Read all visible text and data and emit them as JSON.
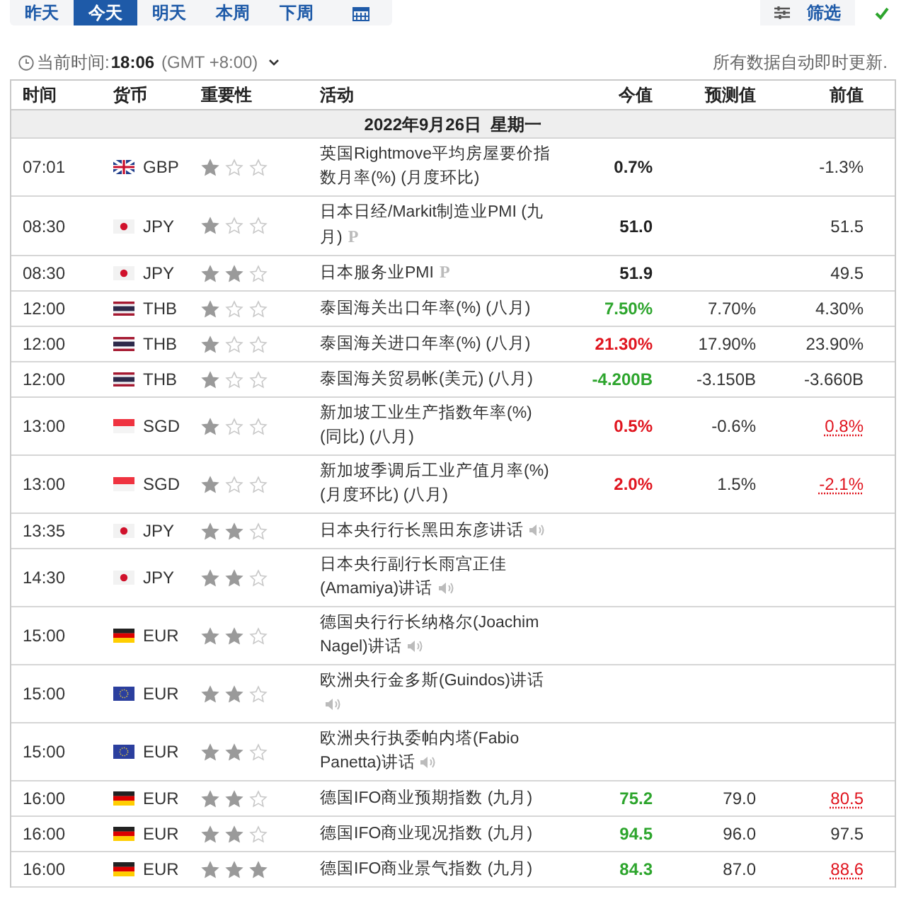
{
  "day_tabs": [
    {
      "label": "昨天",
      "kind": "text",
      "selected": false
    },
    {
      "label": "今天",
      "kind": "text",
      "selected": true
    },
    {
      "label": "明天",
      "kind": "text",
      "selected": false
    },
    {
      "label": "本周",
      "kind": "text",
      "selected": false
    },
    {
      "label": "下周",
      "kind": "text",
      "selected": false
    },
    {
      "kind": "calendar",
      "selected": false
    }
  ],
  "filter_button": {
    "label": "筛选"
  },
  "time_bar": {
    "label": "当前时间:",
    "time": "18:06",
    "timezone": "(GMT +8:00)",
    "notice": "所有数据自动即时更新."
  },
  "table": {
    "columns": [
      "时间",
      "货币",
      "重要性",
      "活动",
      "今值",
      "预测值",
      "前值"
    ],
    "date_heading": "2022年9月26日  星期一",
    "rows": [
      {
        "time": "07:01",
        "flag": {
          "kind": "gb"
        },
        "currency": "GBP",
        "stars": 1,
        "event": "英国Rightmove平均房屋要价指数月率(%) (月度环比)",
        "actual": {
          "text": "0.7%",
          "color": "#222222"
        },
        "previous": "-1.3%",
        "revised": false
      },
      {
        "time": "08:30",
        "flag": {
          "kind": "jp"
        },
        "currency": "JPY",
        "stars": 1,
        "event": "日本日经/Markit制造业PMI (九月)",
        "marker": "P",
        "actual": {
          "text": "51.0",
          "color": "#222222"
        },
        "previous": "51.5",
        "revised": false
      },
      {
        "time": "08:30",
        "flag": {
          "kind": "jp"
        },
        "currency": "JPY",
        "stars": 2,
        "event": "日本服务业PMI",
        "marker": "P",
        "actual": {
          "text": "51.9",
          "color": "#222222"
        },
        "previous": "49.5",
        "revised": false
      },
      {
        "time": "12:00",
        "flag": {
          "kind": "th"
        },
        "currency": "THB",
        "stars": 1,
        "event": "泰国海关出口年率(%) (八月)",
        "actual": {
          "text": "7.50%",
          "color": "#2da52d"
        },
        "forecast": "7.70%",
        "previous": "4.30%",
        "revised": false
      },
      {
        "time": "12:00",
        "flag": {
          "kind": "th"
        },
        "currency": "THB",
        "stars": 1,
        "event": "泰国海关进口年率(%) (八月)",
        "actual": {
          "text": "21.30%",
          "color": "#e0141e"
        },
        "forecast": "17.90%",
        "previous": "23.90%",
        "revised": false
      },
      {
        "time": "12:00",
        "flag": {
          "kind": "th"
        },
        "currency": "THB",
        "stars": 1,
        "event": "泰国海关贸易帐(美元) (八月)",
        "actual": {
          "text": "-4.200B",
          "color": "#2da52d"
        },
        "forecast": "-3.150B",
        "previous": "-3.660B",
        "revised": false
      },
      {
        "time": "13:00",
        "flag": {
          "kind": "sg"
        },
        "currency": "SGD",
        "stars": 1,
        "event": "新加坡工业生产指数年率(%) (同比) (八月)",
        "actual": {
          "text": "0.5%",
          "color": "#e0141e"
        },
        "forecast": "-0.6%",
        "previous": "0.8%",
        "revised": true
      },
      {
        "time": "13:00",
        "flag": {
          "kind": "sg"
        },
        "currency": "SGD",
        "stars": 1,
        "event": "新加坡季调后工业产值月率(%) (月度环比) (八月)",
        "actual": {
          "text": "2.0%",
          "color": "#e0141e"
        },
        "forecast": "1.5%",
        "previous": "-2.1%",
        "revised": true
      },
      {
        "time": "13:35",
        "flag": {
          "kind": "jp"
        },
        "currency": "JPY",
        "stars": 2,
        "event": "日本央行行长黑田东彦讲话",
        "speech": true
      },
      {
        "time": "14:30",
        "flag": {
          "kind": "jp"
        },
        "currency": "JPY",
        "stars": 2,
        "event": "日本央行副行长雨宫正佳(Amamiya)讲话",
        "speech": true
      },
      {
        "time": "15:00",
        "flag": {
          "kind": "de"
        },
        "currency": "EUR",
        "stars": 2,
        "event": "德国央行行长纳格尔(Joachim Nagel)讲话",
        "speech": true
      },
      {
        "time": "15:00",
        "flag": {
          "kind": "eu"
        },
        "currency": "EUR",
        "stars": 2,
        "event": "欧洲央行金多斯(Guindos)讲话",
        "speech": true
      },
      {
        "time": "15:00",
        "flag": {
          "kind": "eu"
        },
        "currency": "EUR",
        "stars": 2,
        "event": "欧洲央行执委帕内塔(Fabio Panetta)讲话",
        "speech": true
      },
      {
        "time": "16:00",
        "flag": {
          "kind": "de"
        },
        "currency": "EUR",
        "stars": 2,
        "event": "德国IFO商业预期指数 (九月)",
        "actual": {
          "text": "75.2",
          "color": "#2da52d"
        },
        "forecast": "79.0",
        "previous": "80.5",
        "revised": true
      },
      {
        "time": "16:00",
        "flag": {
          "kind": "de"
        },
        "currency": "EUR",
        "stars": 2,
        "event": "德国IFO商业现况指数 (九月)",
        "actual": {
          "text": "94.5",
          "color": "#2da52d"
        },
        "forecast": "96.0",
        "previous": "97.5",
        "revised": false
      },
      {
        "time": "16:00",
        "flag": {
          "kind": "de"
        },
        "currency": "EUR",
        "stars": 3,
        "event": "德国IFO商业景气指数 (九月)",
        "actual": {
          "text": "84.3",
          "color": "#2da52d"
        },
        "forecast": "87.0",
        "previous": "88.6",
        "revised": true
      }
    ]
  }
}
